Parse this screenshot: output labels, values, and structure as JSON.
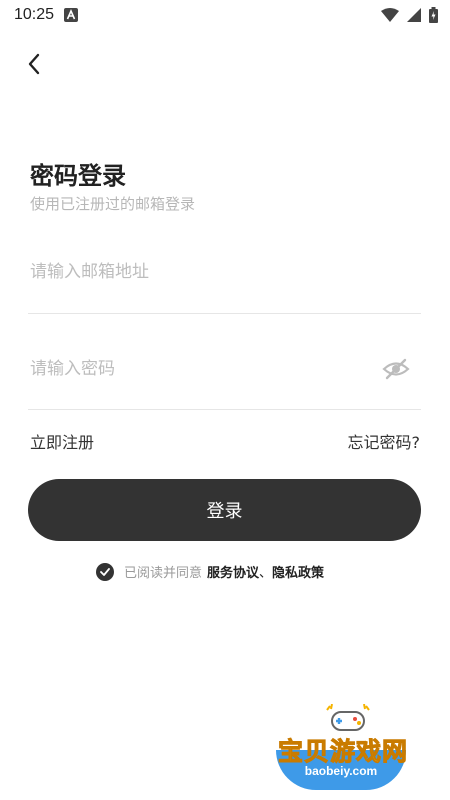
{
  "status_bar": {
    "time": "10:25",
    "icons": [
      "a-notification-icon",
      "wifi-icon",
      "cellular-icon",
      "battery-icon"
    ]
  },
  "header": {
    "back_icon": "chevron-left-icon"
  },
  "login": {
    "title": "密码登录",
    "subtitle": "使用已注册过的邮箱登录",
    "email_placeholder": "请输入邮箱地址",
    "email_value": "",
    "password_placeholder": "请输入密码",
    "password_value": "",
    "visibility_icon": "eye-off-icon",
    "register_label": "立即注册",
    "forgot_label": "忘记密码?",
    "login_button": "登录"
  },
  "agreement": {
    "checked": true,
    "prefix": "已阅读并同意",
    "terms": "服务协议",
    "separator": "、",
    "privacy": "隐私政策"
  },
  "watermark": {
    "title": "宝贝游戏网",
    "url": "baobeiy.com"
  },
  "colors": {
    "primary": "#333333",
    "placeholder": "#bdbdbd",
    "subtitle": "#b7b7b7",
    "divider": "#e6e6e6",
    "watermark_blue": "#3e9ae8",
    "watermark_yellow": "#f5b400"
  }
}
